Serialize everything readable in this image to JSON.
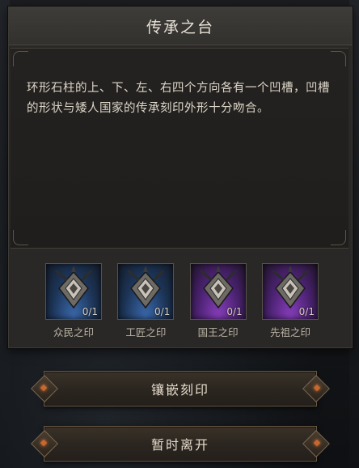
{
  "dialog": {
    "title": "传承之台",
    "description": "环形石柱的上、下、左、右四个方向各有一个凹槽，凹槽的形状与矮人国家的传承刻印外形十分吻合。"
  },
  "seals": [
    {
      "name": "众民之印",
      "count": "0/1",
      "rarity": "blue",
      "icon": "dwarf-seal-icon"
    },
    {
      "name": "工匠之印",
      "count": "0/1",
      "rarity": "blue",
      "icon": "dwarf-seal-icon"
    },
    {
      "name": "国王之印",
      "count": "0/1",
      "rarity": "purple",
      "icon": "dwarf-seal-icon"
    },
    {
      "name": "先祖之印",
      "count": "0/1",
      "rarity": "purple",
      "icon": "dwarf-seal-icon"
    }
  ],
  "buttons": {
    "inlay": "镶嵌刻印",
    "leave": "暂时离开"
  },
  "colors": {
    "blue_rarity": "#3b6bb0",
    "purple_rarity": "#8a3fbf",
    "button_gem": "#c9672d"
  }
}
